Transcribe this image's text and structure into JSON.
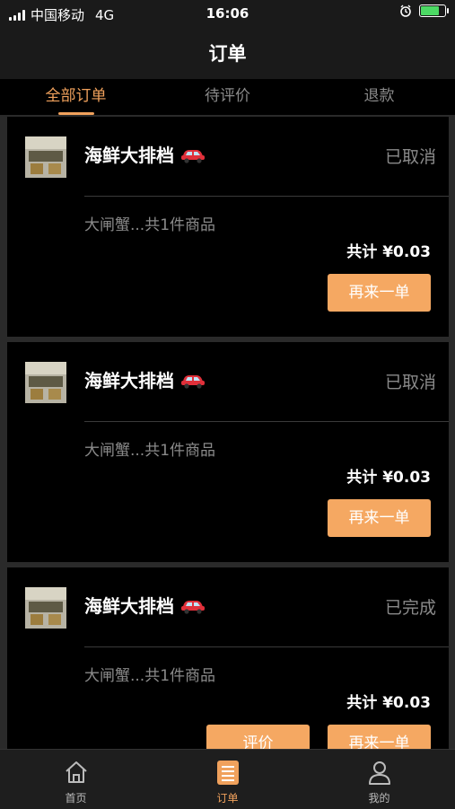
{
  "status_bar": {
    "carrier": "中国移动",
    "network": "4G",
    "time": "16:06"
  },
  "nav": {
    "title": "订单"
  },
  "tabs": [
    {
      "label": "全部订单",
      "active": true
    },
    {
      "label": "待评价",
      "active": false
    },
    {
      "label": "退款",
      "active": false
    }
  ],
  "orders": [
    {
      "shop_name": "海鲜大排档",
      "shop_icon": "car-icon",
      "status": "已取消",
      "summary": "大闸蟹...共1件商品",
      "total": "共计 ¥0.03",
      "actions": [
        {
          "label": "再来一单"
        }
      ]
    },
    {
      "shop_name": "海鲜大排档",
      "shop_icon": "car-icon",
      "status": "已取消",
      "summary": "大闸蟹...共1件商品",
      "total": "共计 ¥0.03",
      "actions": [
        {
          "label": "再来一单"
        }
      ]
    },
    {
      "shop_name": "海鲜大排档",
      "shop_icon": "car-icon",
      "status": "已完成",
      "summary": "大闸蟹...共1件商品",
      "total": "共计 ¥0.03",
      "actions": [
        {
          "label": "评价"
        },
        {
          "label": "再来一单"
        }
      ]
    }
  ],
  "bottom_nav": [
    {
      "label": "首页",
      "icon": "home-icon",
      "active": false
    },
    {
      "label": "订单",
      "icon": "order-list-icon",
      "active": true
    },
    {
      "label": "我的",
      "icon": "profile-icon",
      "active": false
    }
  ],
  "colors": {
    "accent": "#f0a15c",
    "button": "#f5a862",
    "background": "#2a2a2a",
    "card": "#000000"
  }
}
